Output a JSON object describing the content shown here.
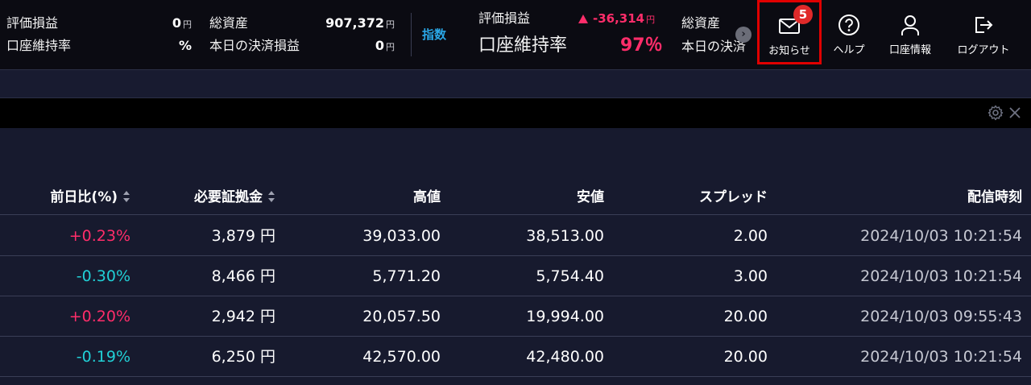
{
  "header": {
    "account": {
      "unrealized_pl_label": "評価損益",
      "unrealized_pl_value": "0",
      "margin_rate_label": "口座維持率",
      "margin_rate_value": "%",
      "total_assets_label": "総資産",
      "total_assets_value": "907,372",
      "realized_today_label": "本日の決済損益",
      "realized_today_value": "0",
      "yen_unit": "円"
    },
    "index_tab_label": "指数",
    "ticker": {
      "unrealized_pl_label": "評価損益",
      "unrealized_pl_delta": "-36,314",
      "yen_unit": "円",
      "margin_rate_label": "口座維持率",
      "margin_rate_value": "97％",
      "total_assets_label": "総資産",
      "realized_today_label": "本日の決済"
    },
    "nav": {
      "notice_label": "お知らせ",
      "notice_count": "5",
      "help_label": "ヘルプ",
      "account_label": "口座情報",
      "logout_label": "ログアウト"
    }
  },
  "colors": {
    "positive": "#ff2d6a",
    "negative": "#21d0d6",
    "index_accent": "#2aa7e6",
    "highlight_border": "#e00000"
  },
  "table": {
    "columns": [
      "前日比(%)",
      "必要証拠金",
      "高値",
      "安値",
      "スプレッド",
      "配信時刻"
    ],
    "margin_unit": "円",
    "rows": [
      {
        "change": "+0.23%",
        "direction": "up",
        "margin": "3,879",
        "high": "39,033.00",
        "low": "38,513.00",
        "spread": "2.00",
        "time": "2024/10/03 10:21:54"
      },
      {
        "change": "-0.30%",
        "direction": "down",
        "margin": "8,466",
        "high": "5,771.20",
        "low": "5,754.40",
        "spread": "3.00",
        "time": "2024/10/03 10:21:54"
      },
      {
        "change": "+0.20%",
        "direction": "up",
        "margin": "2,942",
        "high": "20,057.50",
        "low": "19,994.00",
        "spread": "20.00",
        "time": "2024/10/03 09:55:43"
      },
      {
        "change": "-0.19%",
        "direction": "down",
        "margin": "6,250",
        "high": "42,570.00",
        "low": "42,480.00",
        "spread": "20.00",
        "time": "2024/10/03 10:21:54"
      }
    ]
  }
}
